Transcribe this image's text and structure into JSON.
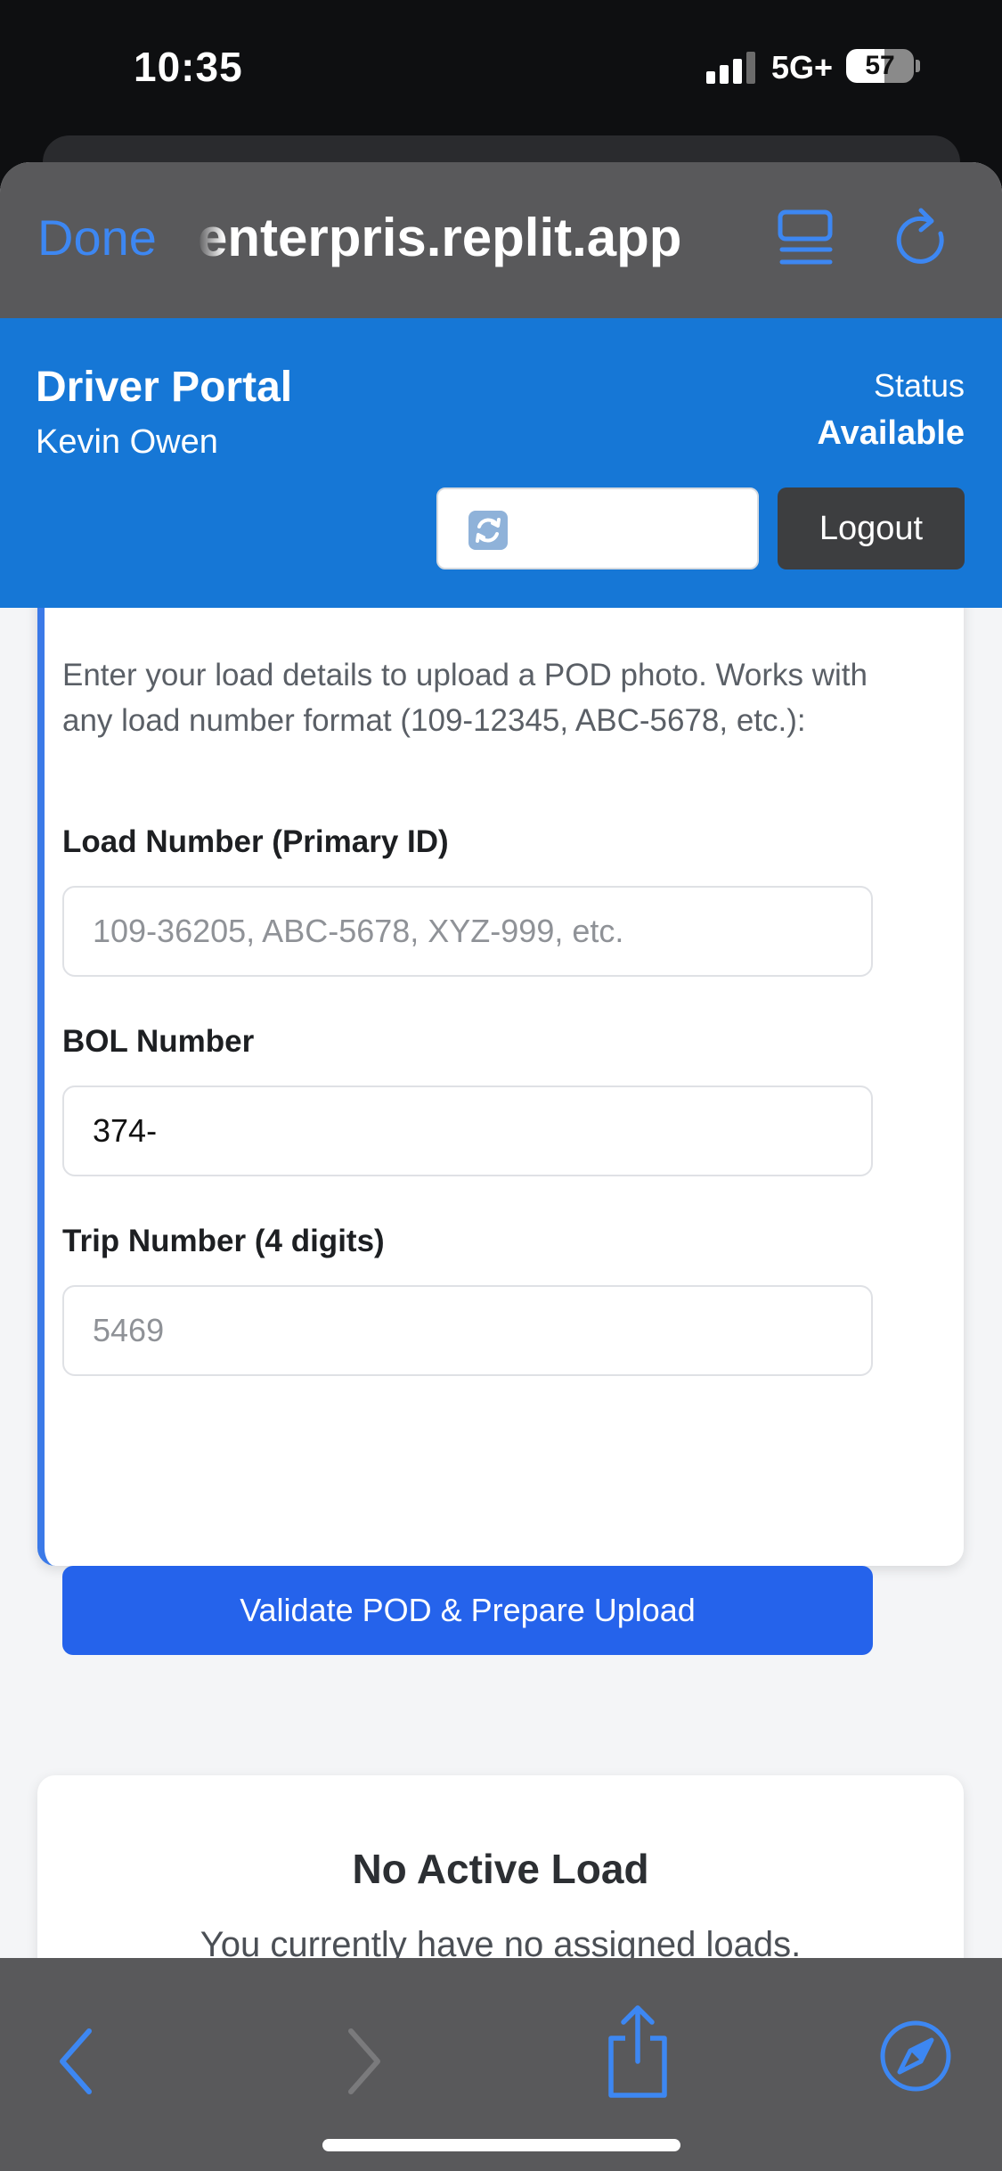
{
  "status_bar": {
    "time": "10:35",
    "network": "5G+",
    "battery": "57",
    "battery_level": 0.57
  },
  "browser": {
    "done_label": "Done",
    "url": "enterpris.replit.app",
    "reader_icon": "reader-icon",
    "reload_icon": "reload-icon"
  },
  "header": {
    "title": "Driver Portal",
    "driver_name": "Kevin Owen",
    "status_label": "Status",
    "status_value": "Available",
    "refresh_icon": "refresh-icon",
    "logout_label": "Logout"
  },
  "pod_form": {
    "intro": "Enter your load details to upload a POD photo. Works with any load number format (109-12345, ABC-5678, etc.):",
    "load_number": {
      "label": "Load Number (Primary ID)",
      "placeholder": "109-36205, ABC-5678, XYZ-999, etc.",
      "value": ""
    },
    "bol_number": {
      "label": "BOL Number",
      "placeholder": "",
      "value": "374-"
    },
    "trip_number": {
      "label": "Trip Number (4 digits)",
      "placeholder": "5469",
      "value": ""
    },
    "submit_label": "Validate POD & Prepare Upload"
  },
  "active_load": {
    "title": "No Active Load",
    "message": "You currently have no assigned loads."
  },
  "toolbar": {
    "back_icon": "chevron-left-icon",
    "forward_icon": "chevron-right-icon",
    "share_icon": "share-icon",
    "compass_icon": "compass-icon"
  },
  "colors": {
    "accent": "#1677d6",
    "button": "#2563eb",
    "safari_blue": "#3d87f2"
  }
}
